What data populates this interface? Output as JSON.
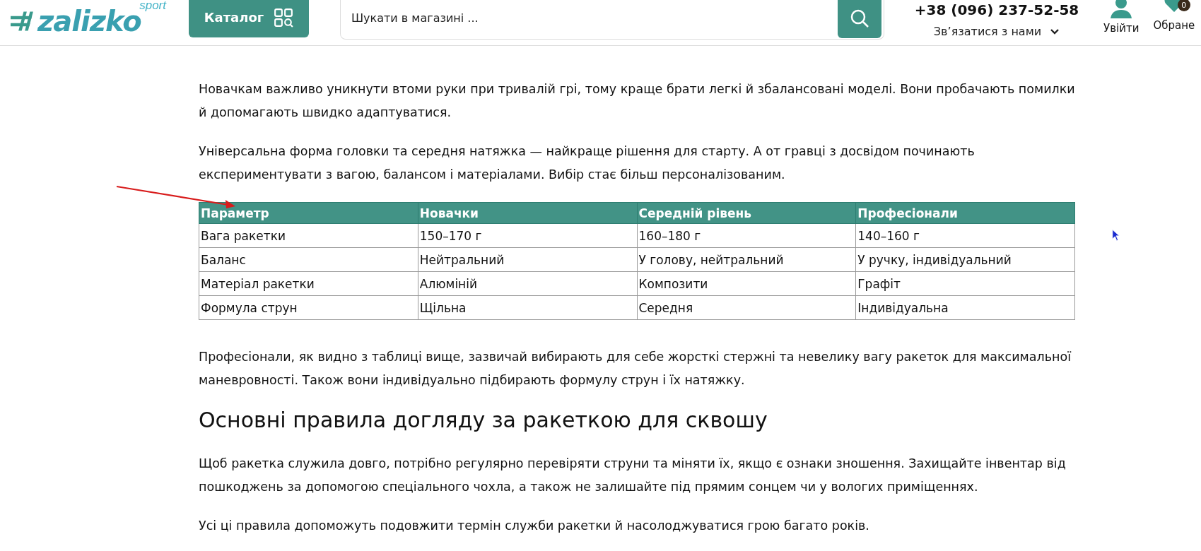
{
  "header": {
    "logo": {
      "brand": "zalizko",
      "sub": "sport"
    },
    "catalog_button": "Каталог",
    "search": {
      "placeholder": "Шукати в магазині ..."
    },
    "phone": "+38 (096) 237-52-58",
    "contact": "Зв’язатися з нами",
    "login": "Увійти",
    "favorites": {
      "label": "Обране",
      "count": "0"
    }
  },
  "article": {
    "paragraphs_before": [
      "Новачкам важливо уникнути втоми руки при тривалій грі, тому краще брати легкі й збалансовані моделі. Вони пробачають помилки й допомагають швидко адаптуватися.",
      "Універсальна форма головки та середня натяжка — найкраще рішення для старту. А от гравці з досвідом починають експериментувати з вагою, балансом і матеріалами. Вибір стає більш персоналізованим."
    ],
    "table": {
      "columns": [
        "Параметр",
        "Новачки",
        "Середній рівень",
        "Професіонали"
      ],
      "rows": [
        [
          "Вага ракетки",
          "150–170 г",
          "160–180 г",
          "140–160 г"
        ],
        [
          "Баланс",
          "Нейтральний",
          "У голову, нейтральний",
          "У ручку, індивідуальний"
        ],
        [
          "Матеріал ракетки",
          "Алюміній",
          "Композити",
          "Графіт"
        ],
        [
          "Формула струн",
          "Щільна",
          "Середня",
          "Індивідуальна"
        ]
      ]
    },
    "paragraphs_after": [
      "Професіонали, як видно з таблиці вище, зазвичай вибирають для себе жорсткі стержні та невелику вагу ракеток для максимальної маневровності. Також вони індивідуально підбирають формулу струн і їх натяжку."
    ],
    "heading": "Основні правила догляду за ракеткою для сквошу",
    "paragraphs_end": [
      "Щоб ракетка служила довго, потрібно регулярно перевіряти струни та міняти їх, якщо є ознаки зношення. Захищайте інвентар від пошкоджень за допомогою спеціального чохла, а також не залишайте під прямим сонцем чи у вологих приміщеннях.",
      "Усі ці правила допоможуть подовжити термін служби ракетки й насолоджуватися грою багато років."
    ]
  }
}
